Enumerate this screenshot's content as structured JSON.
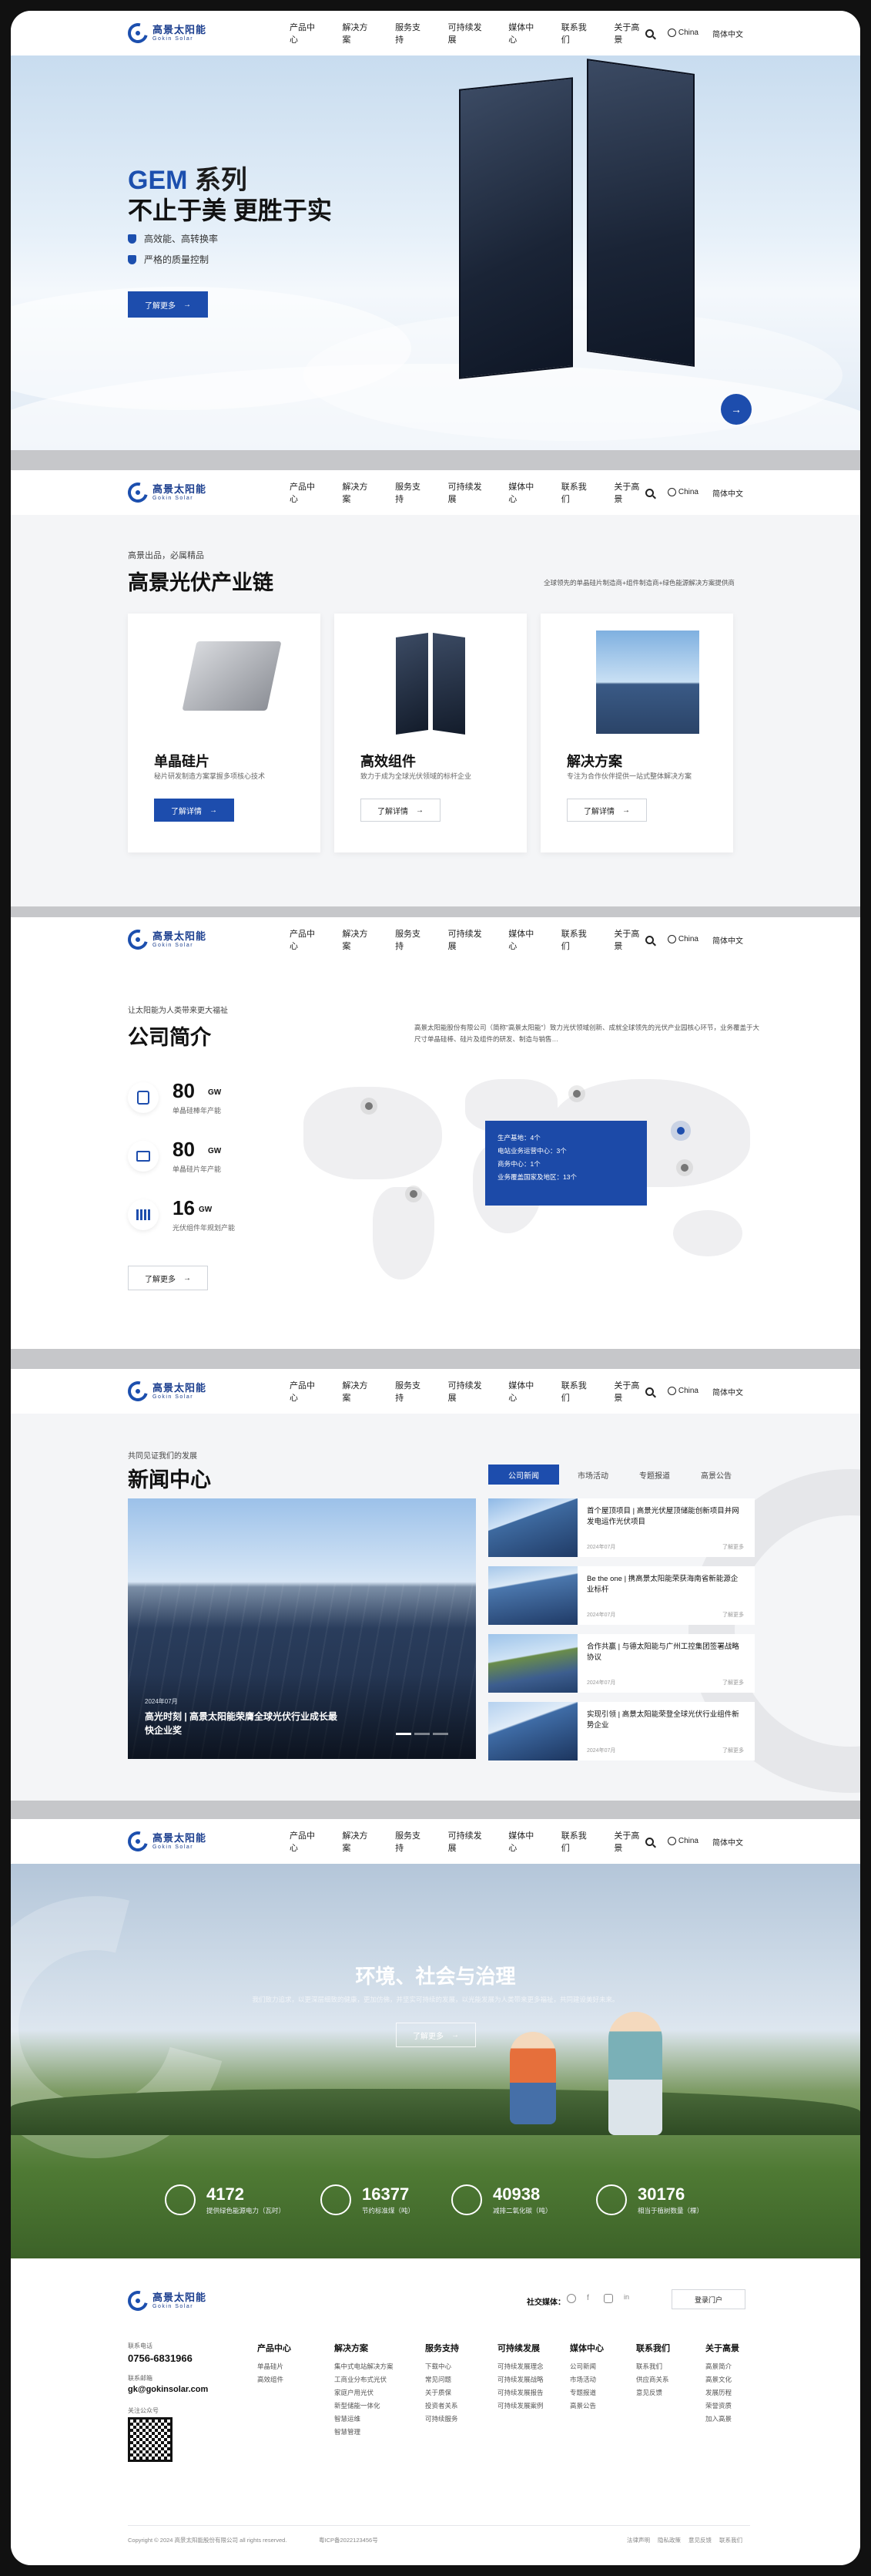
{
  "nav": {
    "logo_cn": "高景太阳能",
    "logo_en": "Gokin Solar",
    "menu": [
      "产品中心",
      "解决方案",
      "服务支持",
      "可持续发展",
      "媒体中心",
      "联系我们",
      "关于高景"
    ],
    "region": "China",
    "lang": "简体中文"
  },
  "hero": {
    "title_a": "GEM",
    "title_b": " 系列",
    "subtitle": "不止于美 更胜于实",
    "features": [
      "高效能、高转换率",
      "严格的质量控制"
    ],
    "button": "了解更多",
    "next": "→"
  },
  "chain": {
    "sub": "高景出品，必属精品",
    "title": "高景光伏产业链",
    "desc": "全球领先的单晶硅片制造商+组件制造商+绿色能源解决方案提供商",
    "cards": [
      {
        "title": "单晶硅片",
        "desc": "秘片研发制造方案掌握多项核心技术",
        "button": "了解详情"
      },
      {
        "title": "高效组件",
        "desc": "致力于成为全球光伏领域的标杆企业",
        "button": "了解详情"
      },
      {
        "title": "解决方案",
        "desc": "专注为合作伙伴提供一站式整体解决方案",
        "button": "了解详情"
      }
    ]
  },
  "company": {
    "sub": "让太阳能为人类带来更大福祉",
    "title": "公司简介",
    "desc": "高景太阳能股份有限公司（简称\"高景太阳能\"）致力光伏领域创新、成就全球领先的光伏产业园核心环节，业务覆盖于大尺寸单晶硅棒、硅片及组件的研发、制造与销售…",
    "stats": [
      {
        "num": "80",
        "unit": "GW",
        "label": "单晶硅棒年产能"
      },
      {
        "num": "80",
        "unit": "GW",
        "label": "单晶硅片年产能"
      },
      {
        "num": "16",
        "unit": "GW",
        "label": "光伏组件年规划产能"
      }
    ],
    "button": "了解更多",
    "map_box": [
      "生产基地：4个",
      "电站业务运营中心：3个",
      "商务中心：1个",
      "业务覆盖国家及地区：13个"
    ]
  },
  "news": {
    "sub": "共同见证我们的发展",
    "title": "新闻中心",
    "tabs": [
      "公司新闻",
      "市场活动",
      "专题报道",
      "高景公告"
    ],
    "feature_date": "2024年07月",
    "feature_title": "高光时刻 | 高景太阳能荣膺全球光伏行业成长最快企业奖",
    "items": [
      {
        "title": "首个屋顶项目 | 高景光伏屋顶储能创新项目并网发电运作光伏项目",
        "date": "2024年07月",
        "more": "了解更多"
      },
      {
        "title": "Be the one | 携高景太阳能荣获海南省新能源企业标杆",
        "date": "2024年07月",
        "more": "了解更多"
      },
      {
        "title": "合作共赢 | 与德太阳能与广州工控集团签署战略协议",
        "date": "2024年07月",
        "more": "了解更多"
      },
      {
        "title": "实现引领 | 高景太阳能荣登全球光伏行业组件新势企业",
        "date": "2024年07月",
        "more": "了解更多"
      }
    ]
  },
  "esg": {
    "title": "环境、社会与治理",
    "desc": "我们致力追求，以更深层细致的健康，更加仿佛，并坚实可持续的发展，以光能发展为人类带来更多福祉，共同建设美好未来。",
    "button": "了解更多",
    "stats": [
      {
        "num": "4172",
        "label": "提供绿色能源电力（瓦时）"
      },
      {
        "num": "16377",
        "label": "节约标准煤（吨）"
      },
      {
        "num": "40938",
        "label": "减排二氧化碳（吨）"
      },
      {
        "num": "30176",
        "label": "相当于植树数量（棵）"
      }
    ]
  },
  "footer": {
    "social_label": "社交媒体：",
    "login": "登录门户",
    "hotline_label": "联系电话",
    "hotline": "0756-6831966",
    "email_label": "联系邮箱",
    "email": "gk@gokinsolar.com",
    "qr_label": "关注公众号",
    "columns": [
      {
        "title": "产品中心",
        "items": [
          "单晶硅片",
          "高效组件"
        ]
      },
      {
        "title": "解决方案",
        "items": [
          "集中式电站解决方案",
          "工商业分布式光伏",
          "家庭户用光伏",
          "新型储能一体化",
          "智慧运维",
          "智慧管理"
        ]
      },
      {
        "title": "服务支持",
        "items": [
          "下载中心",
          "常见问题",
          "关于质保",
          "投资者关系",
          "可持续服务"
        ]
      },
      {
        "title": "可持续发展",
        "items": [
          "可持续发展理念",
          "可持续发展战略",
          "可持续发展报告",
          "可持续发展案例"
        ]
      },
      {
        "title": "媒体中心",
        "items": [
          "公司新闻",
          "市场活动",
          "专题报道",
          "高景公告"
        ]
      },
      {
        "title": "联系我们",
        "items": [
          "联系我们",
          "供应商关系",
          "意见反馈"
        ]
      },
      {
        "title": "关于高景",
        "items": [
          "高景简介",
          "高景文化",
          "发展历程",
          "荣誉资质",
          "加入高景"
        ]
      }
    ],
    "copyright": "Copyright © 2024 高景太阳能股份有限公司 all rights reserved.",
    "icp": "粤ICP备2022123456号",
    "links": [
      "法律声明",
      "隐私政策",
      "意见反馈",
      "联系我们"
    ]
  },
  "colors": {
    "brand": "#1d4dad",
    "dark": "#111111",
    "frame": "#c6c7ca"
  }
}
